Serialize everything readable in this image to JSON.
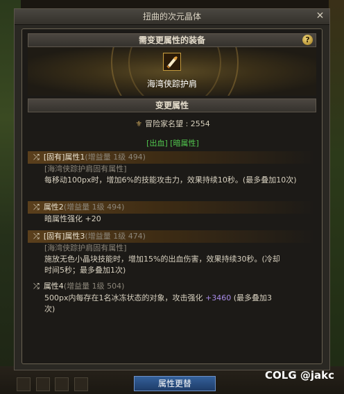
{
  "window": {
    "title": "扭曲的次元晶体",
    "close_label": "✕"
  },
  "panel": {
    "header": "需变更属性的装备",
    "help_label": "?",
    "item_icon": "shoulder-armor-icon",
    "item_name": "海湾侠踪护肩",
    "section_title": "变更属性",
    "fame_label": "冒险家名望 : 2554",
    "tags": "[出血] [暗属性]"
  },
  "attributes": [
    {
      "head": "[固有]属性1",
      "meta": "(增益量 1级 494)",
      "source": "[海湾侠踪护肩固有属性]",
      "lines": [
        "每移动100px时，增加6%的技能攻击力，效果持续10秒。(最多叠加10次)"
      ]
    },
    {
      "head": "属性2",
      "meta": "(增益量 1级 494)",
      "source": "",
      "lines": [
        "暗属性强化 +20"
      ]
    },
    {
      "head": "[固有]属性3",
      "meta": "(增益量 1级 474)",
      "source": "[海湾侠踪护肩固有属性]",
      "lines": [
        "施放无色小晶块技能时，增加15%的出血伤害，效果持续30秒。(冷却",
        "时间5秒；最多叠加1次)"
      ]
    },
    {
      "head": "属性4",
      "meta": "(增益量 1级 504)",
      "source": "",
      "line_a": "500px内每存在1名冰冻状态的对象，攻击强化 ",
      "line_a_value": "+3460",
      "line_a_tail": " (最多叠加3",
      "line_b": "次)"
    }
  ],
  "footer": {
    "button_label": "属性更替"
  },
  "watermark": "COLG @jakc",
  "colors": {
    "tag_green": "#52c84f",
    "value_purple": "#a88be8",
    "button_blue": "#2a4f86"
  }
}
